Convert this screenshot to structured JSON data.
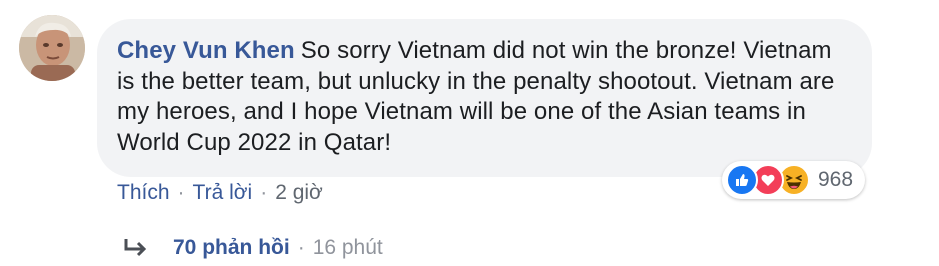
{
  "comment": {
    "author": "Chey Vun Khen",
    "text": "So sorry Vietnam did not win the bronze! Vietnam is the better team, but unlucky in the penalty shootout. Vietnam are my heroes, and I hope Vietnam will be one of the Asian teams in World Cup 2022 in Qatar!"
  },
  "actions": {
    "like_label": "Thích",
    "reply_label": "Trả lời",
    "separator": "·",
    "time": "2 giờ"
  },
  "reactions": {
    "icons": [
      "like-icon",
      "love-icon",
      "haha-icon"
    ],
    "count": "968",
    "colors": {
      "like": "#1877f2",
      "love": "#f33e58",
      "haha": "#f7b125"
    }
  },
  "replies": {
    "label": "70 phản hồi",
    "separator": "·",
    "time": "16 phút"
  },
  "colors": {
    "link": "#385898",
    "bubble": "#f2f3f5",
    "meta": "#606770"
  }
}
